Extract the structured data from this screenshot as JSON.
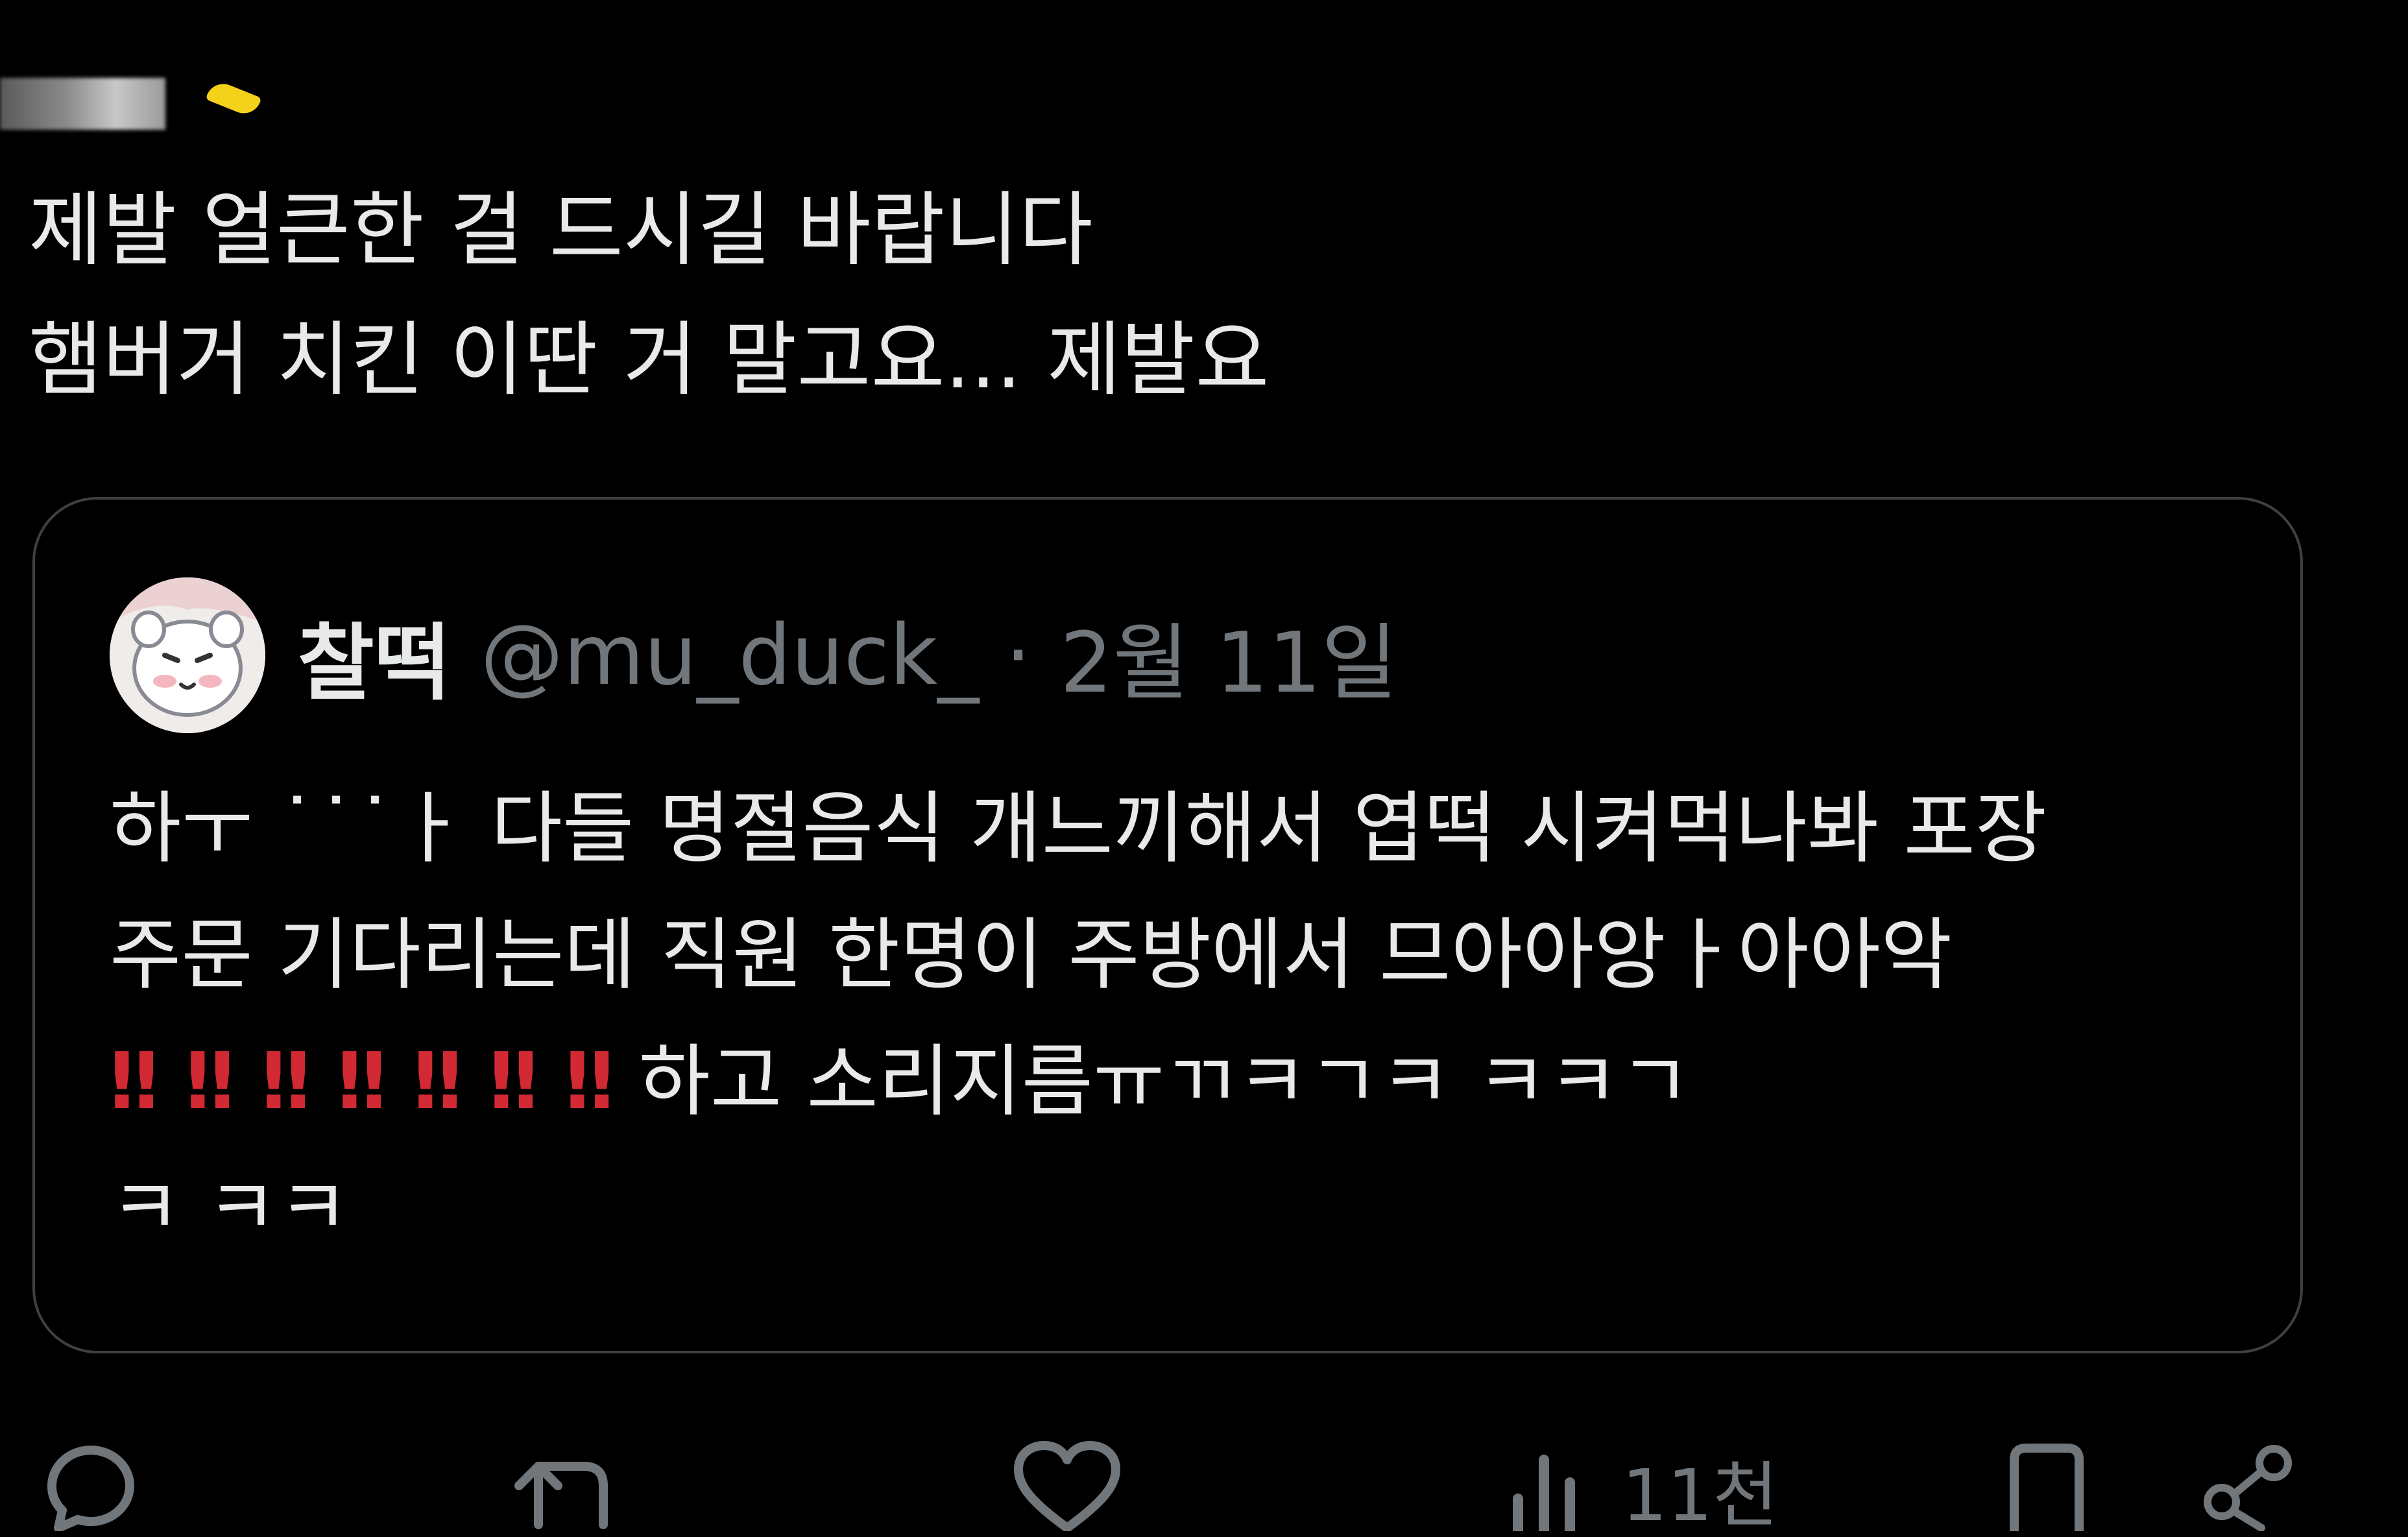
{
  "tweet": {
    "lines": [
      "제발 얼큰한 걸 드시길 바랍니다",
      "햄버거 치킨 이딴 거 말고요... 제발요"
    ]
  },
  "quote": {
    "display_name": "찰떡",
    "handle": "@mu_duck_",
    "separator": "·",
    "date": "2월 11일",
    "text_lines": [
      "하ㅜ ˙˙˙ㅏ 다들 명절음식 개느끼해서 엽떡 시켜먹나봐 포장",
      "주문 기다리는데 직원 한명이 주방에서 므아아앙ㅏ아아악",
      "하고 소리지름ㅠㄲㅋㄱㅋ ㅋㅋㄱ",
      "ㅋ ㅋㅋ"
    ],
    "emphasis": "‼ ‼ ‼ ‼ ‼ ‼ ‼"
  },
  "actions": {
    "reply_icon": "reply-icon",
    "retweet_icon": "retweet-icon",
    "like_icon": "heart-icon",
    "views_icon": "views-icon",
    "views_count": "11천",
    "bookmark_icon": "bookmark-icon",
    "share_icon": "share-icon"
  },
  "colors": {
    "background": "#000000",
    "text": "#e7e9ea",
    "muted": "#71767b",
    "border": "#3e4144",
    "emphasis": "#d12a35"
  }
}
